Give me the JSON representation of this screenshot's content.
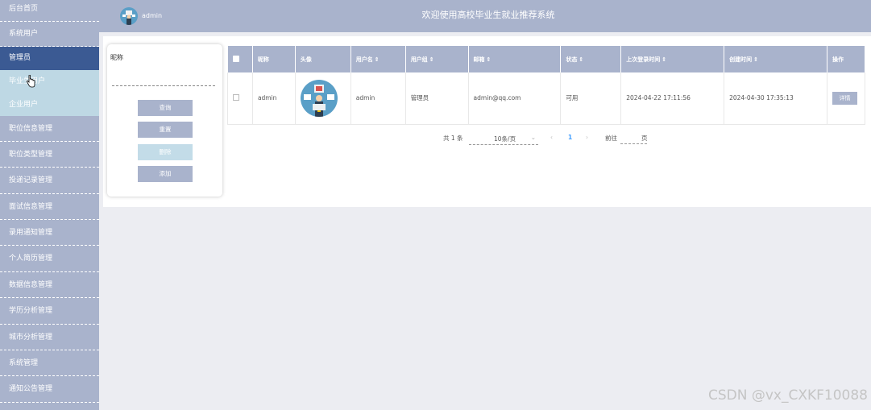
{
  "sidebar": {
    "items": [
      {
        "label": "后台首页"
      },
      {
        "label": "系统用户"
      },
      {
        "label": "管理员"
      },
      {
        "label": "毕业生用户"
      },
      {
        "label": "企业用户"
      },
      {
        "label": "职位信息管理"
      },
      {
        "label": "职位类型管理"
      },
      {
        "label": "投递记录管理"
      },
      {
        "label": "面试信息管理"
      },
      {
        "label": "录用通知管理"
      },
      {
        "label": "个人简历管理"
      },
      {
        "label": "数据信息管理"
      },
      {
        "label": "学历分析管理"
      },
      {
        "label": "城市分析管理"
      },
      {
        "label": "系统管理"
      },
      {
        "label": "通知公告管理"
      }
    ]
  },
  "header": {
    "username": "admin",
    "title": "欢迎使用高校毕业生就业推荐系统"
  },
  "search": {
    "nickname_label": "昵称",
    "nickname_value": "",
    "query_label": "查询",
    "reset_label": "重置",
    "delete_label": "删除",
    "add_label": "添加"
  },
  "table": {
    "headers": [
      "昵称",
      "头像",
      "用户名",
      "用户组",
      "邮箱",
      "状态",
      "上次登录时间",
      "创建时间",
      "操作"
    ],
    "sort_glyph": "⇕",
    "rows": [
      {
        "nickname": "admin",
        "avatar": "avatar-image",
        "username": "admin",
        "group": "管理员",
        "email": "admin@qq.com",
        "status": "可用",
        "last_login": "2024-04-22 17:11:56",
        "created": "2024-04-30 17:35:13",
        "action": "详情"
      }
    ]
  },
  "pagination": {
    "total": "共 1 条",
    "page_size": "10条/页",
    "prev": "‹",
    "current": "1",
    "next": "›",
    "goto_label": "前往",
    "page_unit": "页"
  },
  "watermark": "CSDN @vx_CXKF10088",
  "colors": {
    "sidebar": "#a9b3cc",
    "active": "#3b5a93",
    "submenu": "#bed8e4",
    "page_link": "#409eff"
  }
}
